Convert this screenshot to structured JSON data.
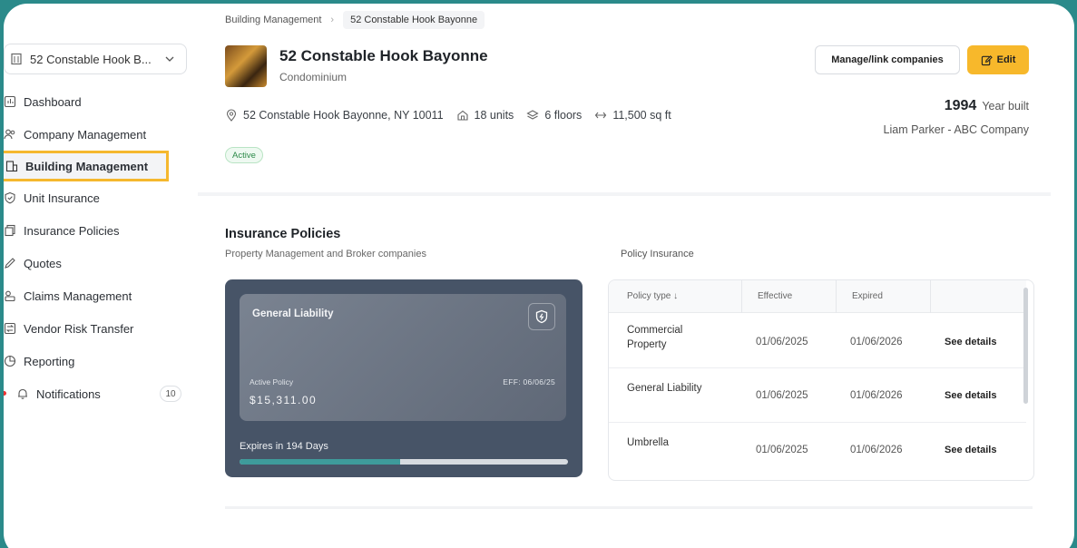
{
  "sidebar": {
    "property_select": "52 Constable Hook B...",
    "items": [
      {
        "label": "Dashboard"
      },
      {
        "label": "Company Management"
      },
      {
        "label": "Building Management"
      },
      {
        "label": "Unit Insurance"
      },
      {
        "label": "Insurance Policies"
      },
      {
        "label": "Quotes"
      },
      {
        "label": "Claims Management"
      },
      {
        "label": "Vendor Risk Transfer"
      },
      {
        "label": "Reporting"
      },
      {
        "label": "Notifications",
        "count": "10"
      }
    ]
  },
  "breadcrumb": {
    "parent": "Building Management",
    "current": "52 Constable Hook Bayonne"
  },
  "building": {
    "name": "52 Constable Hook Bayonne",
    "type": "Condominium",
    "address": "52 Constable Hook Bayonne, NY 10011",
    "units": "18 units",
    "floors": "6 floors",
    "area": "11,500 sq ft",
    "status": "Active",
    "year_built": "1994",
    "year_built_label": "Year built",
    "owner": "Liam Parker - ABC Company"
  },
  "actions": {
    "manage_label": "Manage/link companies",
    "edit_label": "Edit"
  },
  "insurance": {
    "title": "Insurance Policies",
    "subtitle": "Property Management and Broker companies",
    "policy_label": "Policy Insurance",
    "card": {
      "name": "General Liability",
      "active_label": "Active Policy",
      "eff": "EFF: 06/06/25",
      "amount": "$15,311.00",
      "expires": "Expires in 194 Days",
      "progress": 0.49
    },
    "table": {
      "headers": {
        "type": "Policy type",
        "effective": "Effective",
        "expired": "Expired"
      },
      "rows": [
        {
          "type": "Commercial Property",
          "effective": "01/06/2025",
          "expired": "01/06/2026",
          "action": "See details"
        },
        {
          "type": "General Liability",
          "effective": "01/06/2025",
          "expired": "01/06/2026",
          "action": "See details"
        },
        {
          "type": "Umbrella",
          "effective": "01/06/2025",
          "expired": "01/06/2026",
          "action": "See details"
        }
      ]
    }
  },
  "colors": {
    "accent": "#f7b82b",
    "frame": "#2b8a8a",
    "card": "#475467",
    "progress": "#3e9b9b",
    "active_badge": "#2c8a49"
  }
}
